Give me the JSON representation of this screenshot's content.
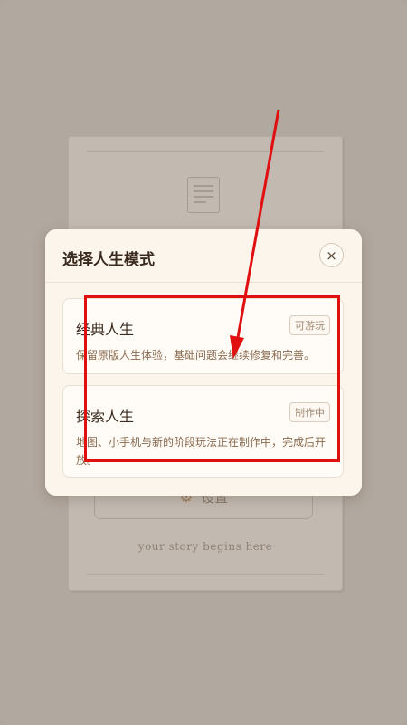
{
  "background": {
    "settings_label": "设置",
    "tagline": "your story begins here"
  },
  "modal": {
    "title": "选择人生模式",
    "close_label": "×",
    "modes": [
      {
        "title": "经典人生",
        "badge": "可游玩",
        "description": "保留原版人生体验，基础问题会继续修复和完善。"
      },
      {
        "title": "探索人生",
        "badge": "制作中",
        "description": "地图、小手机与新的阶段玩法正在制作中，完成后开放。"
      }
    ]
  },
  "annotation_color": "#e01010",
  "icons": {
    "doc": "document-icon",
    "settings": "gear-icon",
    "close": "close-icon"
  }
}
